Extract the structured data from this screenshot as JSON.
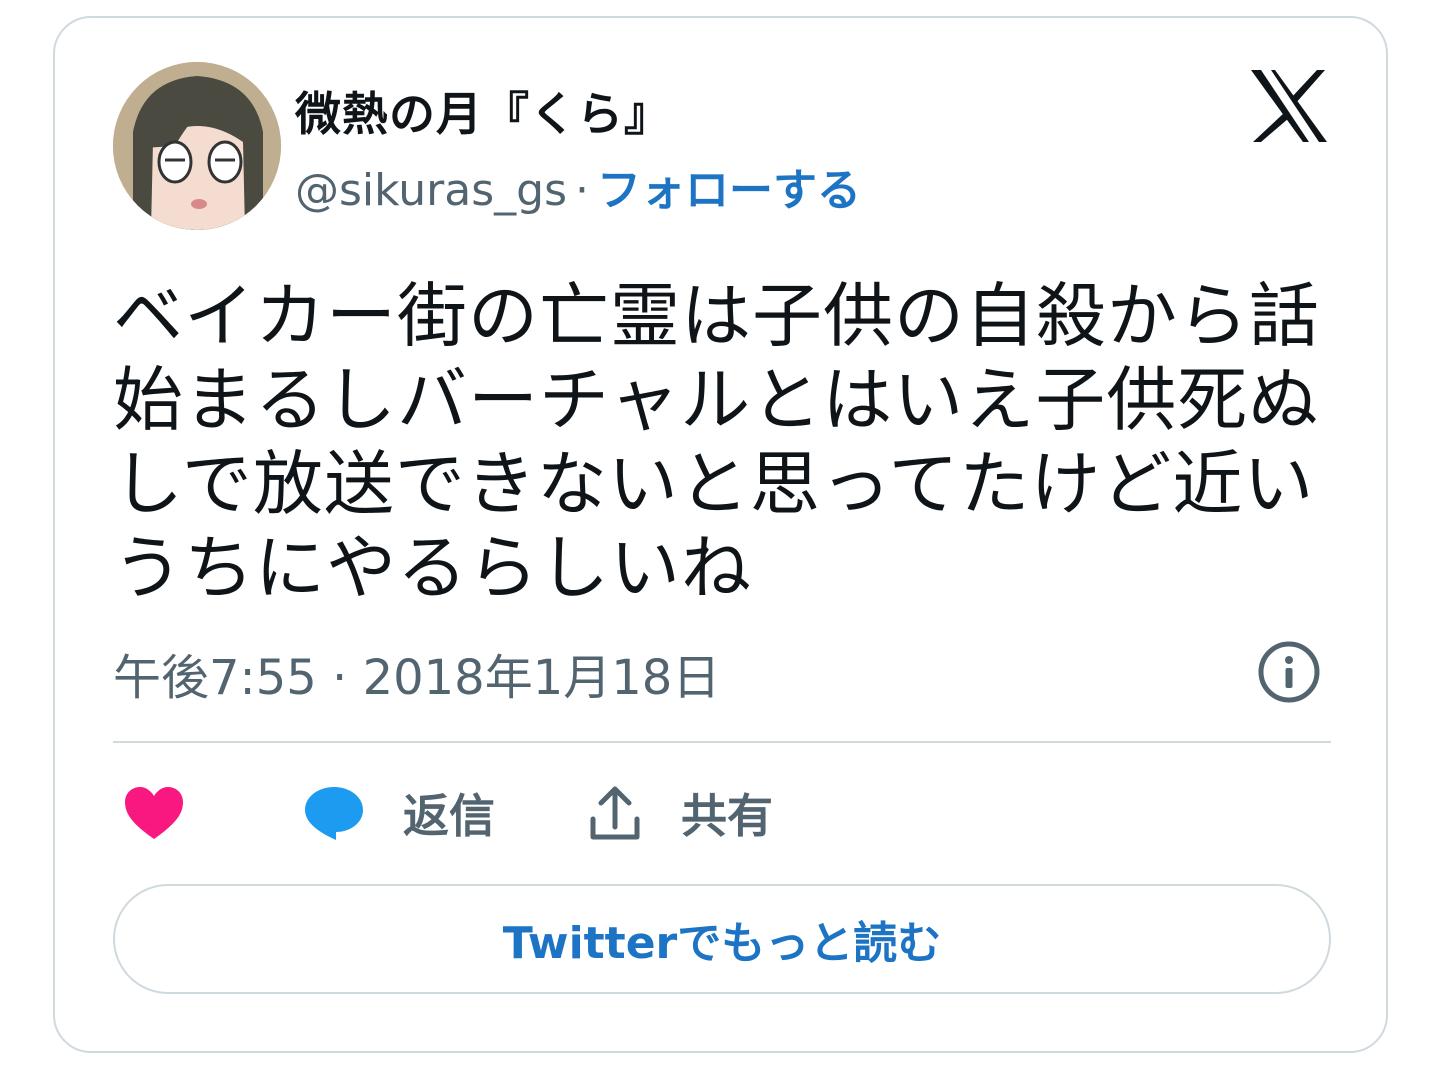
{
  "user": {
    "display_name": "微熱の月『くら』",
    "handle": "@sikuras_gs",
    "separator": "·",
    "follow_label": "フォローする"
  },
  "tweet": {
    "text": "ベイカー街の亡霊は子供の自殺から話始まるしバーチャルとはいえ子供死ぬしで放送できないと思ってたけど近いうちにやるらしいね",
    "timestamp": "午後7:55 · 2018年1月18日"
  },
  "actions": {
    "reply_label": "返信",
    "share_label": "共有"
  },
  "read_more_label": "Twitterでもっと読む",
  "colors": {
    "like": "#f91880",
    "reply": "#1d9bf0",
    "link": "#1d74c4",
    "secondary_text": "#536471",
    "border": "#cfd9de"
  }
}
